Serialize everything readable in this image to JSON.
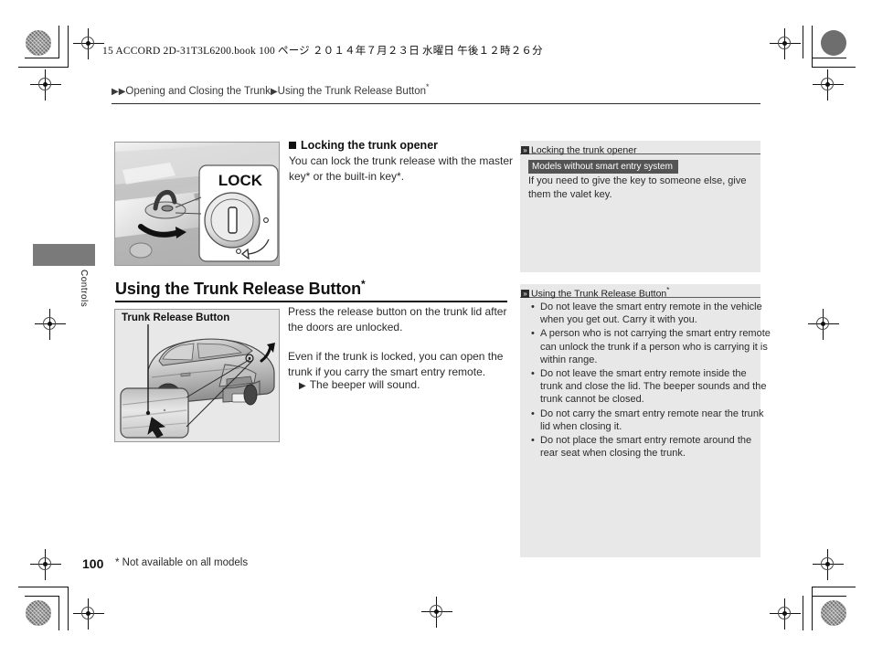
{
  "print_header": "15 ACCORD 2D-31T3L6200.book   100 ページ   ２０１４年７月２３日   水曜日   午後１２時２６分",
  "breadcrumb": {
    "arrow_double": "▶▶",
    "parent": "Opening and Closing the Trunk",
    "arrow_single": "▶",
    "current": "Using the Trunk Release Button",
    "star": "*"
  },
  "side_tab": {
    "label": "Controls"
  },
  "figures": {
    "lock": {
      "caption": "LOCK",
      "alt_name": "trunk-lock-cylinder-illustration"
    },
    "trunk": {
      "caption": "Trunk Release Button",
      "alt_name": "coupe-rear-trunk-release-illustration"
    }
  },
  "main": {
    "sub_heading": "Locking the trunk opener",
    "sub_heading_body": "You can lock the trunk release with the master key* or the built-in key*.",
    "section_title": "Using the Trunk Release Button",
    "section_title_star": "*",
    "paragraph_1": "Press the release button on the trunk lid after the doors are unlocked.",
    "paragraph_2": "Even if the trunk is locked, you can open the trunk if you carry the smart entry remote.",
    "beeper_arrow": "▶",
    "beeper_note": "The beeper will sound."
  },
  "panels": [
    {
      "title": "Locking the trunk opener",
      "icon": "double-chevron-right-icon",
      "star": "",
      "badge": "Models without smart entry system",
      "note": "If you need to give the key to someone else, give them the valet key.",
      "bullets": []
    },
    {
      "title": "Using the Trunk Release Button",
      "icon": "double-chevron-right-icon",
      "star": "*",
      "badge": "",
      "note": "",
      "bullets": [
        "Do not leave the smart entry remote in the vehicle when you get out. Carry it with you.",
        "A person who is not carrying the smart entry remote can unlock the trunk if a person who is carrying it is within range.",
        "Do not leave the smart entry remote inside the trunk and close the lid. The beeper sounds and the trunk cannot be closed.",
        "Do not carry the smart entry remote near the trunk lid when closing it.",
        "Do not place the smart entry remote around the rear seat when closing the trunk."
      ]
    }
  ],
  "footer": {
    "page_number": "100",
    "footnote": "* Not available on all models"
  },
  "colors": {
    "panel_background": "#e8e8e8",
    "badge_background": "#545454",
    "side_tab": "#7a7a7a",
    "text": "#2b2b2b"
  }
}
